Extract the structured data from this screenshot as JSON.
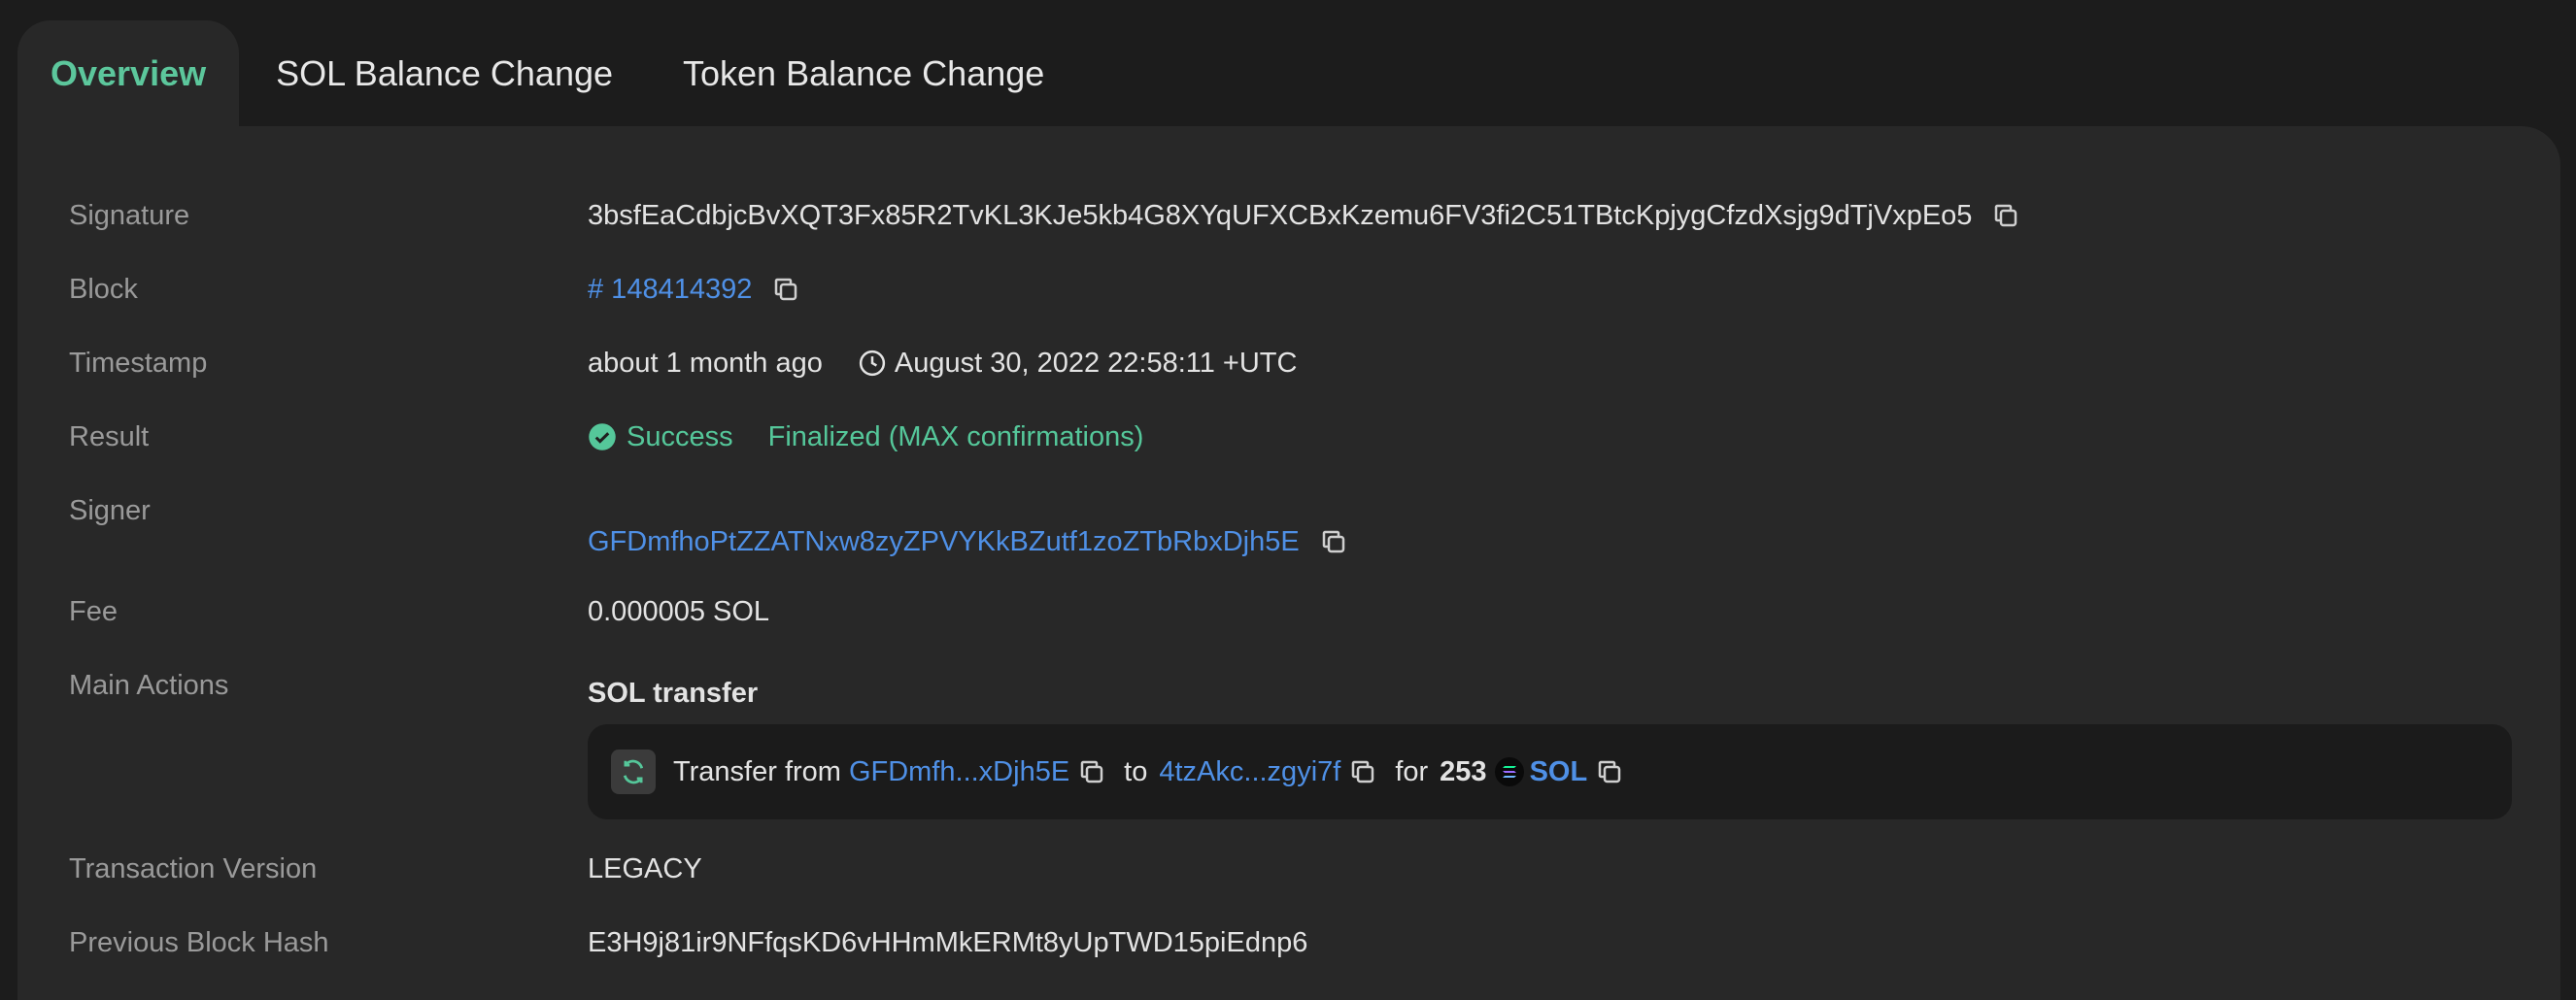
{
  "tabs": {
    "overview": "Overview",
    "sol_balance": "SOL Balance Change",
    "token_balance": "Token Balance Change"
  },
  "labels": {
    "signature": "Signature",
    "block": "Block",
    "timestamp": "Timestamp",
    "result": "Result",
    "signer": "Signer",
    "fee": "Fee",
    "main_actions": "Main Actions",
    "tx_version": "Transaction Version",
    "prev_hash": "Previous Block Hash"
  },
  "values": {
    "signature": "3bsfEaCdbjcBvXQT3Fx85R2TvKL3KJe5kb4G8XYqUFXCBxKzemu6FV3fi2C51TBtcKpjygCfzdXsjg9dTjVxpEo5",
    "block": "# 148414392",
    "timestamp_relative": "about 1 month ago",
    "timestamp_absolute": "August 30, 2022 22:58:11 +UTC",
    "result_status": "Success",
    "result_finality": "Finalized (MAX confirmations)",
    "signer": "GFDmfhoPtZZATNxw8zyZPVYKkBZutf1zoZTbRbxDjh5E",
    "fee": "0.000005 SOL",
    "action_title": "SOL transfer",
    "tx_version": "LEGACY",
    "prev_hash": "E3H9j81ir9NFfqsKD6vHHmMkERMt8yUpTWD15piEdnp6"
  },
  "transfer": {
    "prefix": "Transfer from",
    "from": "GFDmfh...xDjh5E",
    "to_word": "to",
    "to": "4tzAkc...zgyi7f",
    "for_word": "for",
    "amount": "253",
    "token": "SOL"
  },
  "colors": {
    "accent_green": "#55c79a",
    "link_blue": "#4f90e6",
    "background": "#1c1c1c",
    "panel": "#282828"
  },
  "icons": [
    "copy-icon",
    "check-circle-icon",
    "clock-icon",
    "transfer-icon",
    "solana-logo-icon"
  ]
}
